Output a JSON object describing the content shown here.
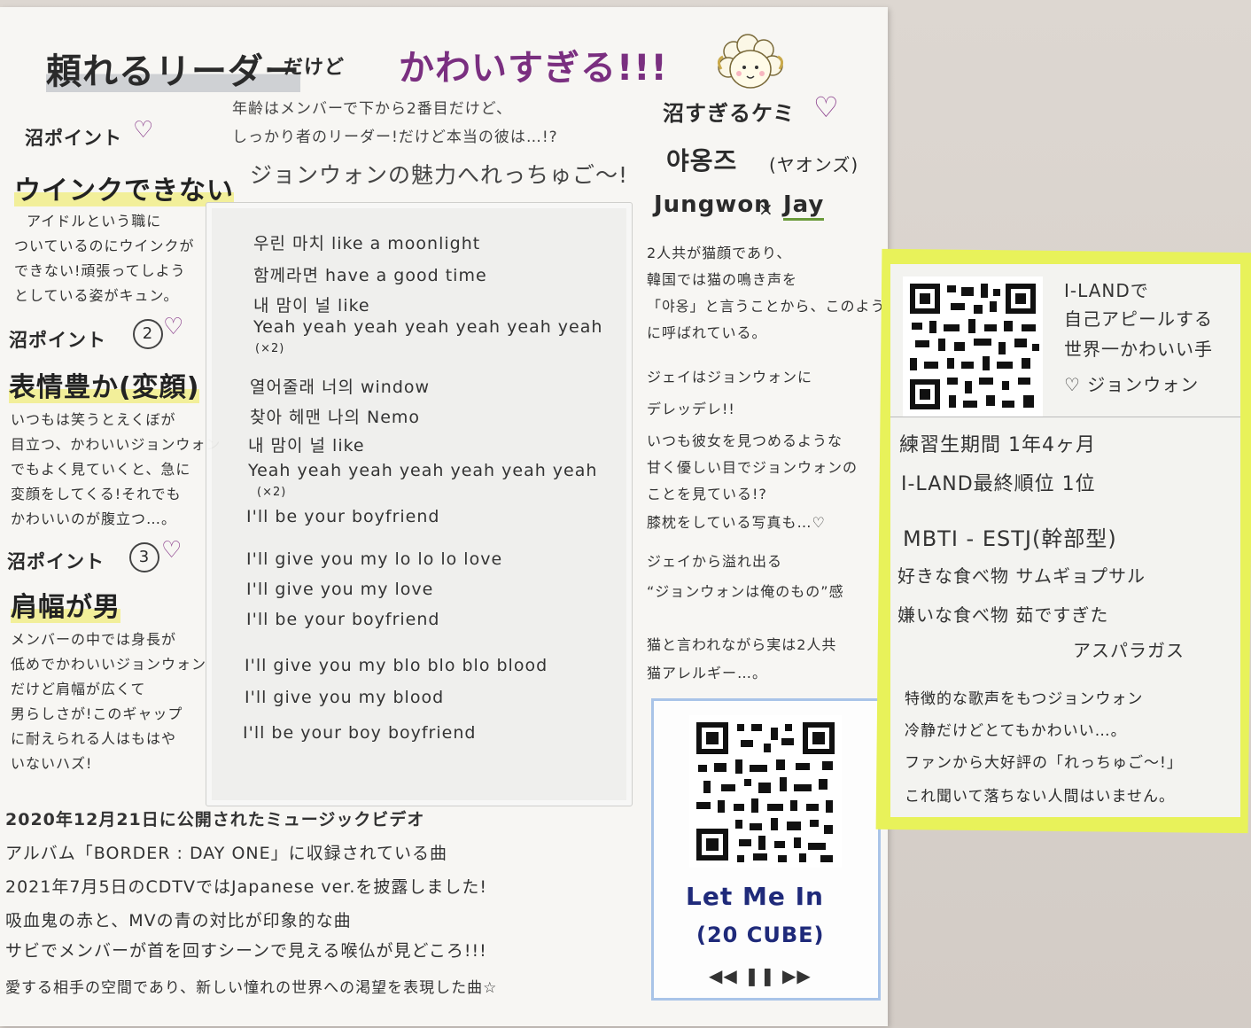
{
  "title": {
    "left": "頼れるリーダー",
    "mid": "だけど",
    "right": "かわいすぎる!!!"
  },
  "subtitle": {
    "line1": "年齢はメンバーで下から2番目だけど、",
    "line2": "しっかり者のリーダー!だけど本当の彼は…!?",
    "line3": "ジョンウォンの魅力へれっちゅご〜!"
  },
  "points": [
    {
      "label": "沼ポイント",
      "num": "",
      "heading": "ウインクできない",
      "body": [
        "アイドルという職に",
        "ついているのにウインクが",
        "できない!頑張ってしよう",
        "としている姿がキュン。"
      ]
    },
    {
      "label": "沼ポイント",
      "num": "2",
      "heading": "表情豊か(変顔)",
      "body": [
        "いつもは笑うとえくぼが",
        "目立つ、かわいいジョンウォン",
        "でもよく見ていくと、急に",
        "変顔をしてくる!それでも",
        "かわいいのが腹立つ…。"
      ]
    },
    {
      "label": "沼ポイント",
      "num": "3",
      "heading": "肩幅が男",
      "body": [
        "メンバーの中では身長が",
        "低めでかわいいジョンウォン",
        "だけど肩幅が広くて",
        "男らしさが!このギャップ",
        "に耐えられる人はもはや",
        "いないハズ!"
      ]
    }
  ],
  "lyrics": [
    "우린 마치 like a moonlight",
    "함께라면 have a good time",
    "내 맘이 널 like",
    "Yeah yeah yeah yeah yeah yeah yeah",
    "(×2)",
    "열어줄래 너의 window",
    "찾아 헤맨 나의 Nemo",
    "내 맘이 널 like",
    "Yeah yeah yeah yeah yeah yeah yeah",
    "(×2)",
    "I'll be your boyfriend",
    "I'll give you my lo lo lo love",
    "I'll give you my love",
    "I'll be your boyfriend",
    "I'll give you my blo blo blo blood",
    "I'll give you my blood",
    "I'll be your boy boyfriend"
  ],
  "chemistry": {
    "heading": "沼すぎるケミ",
    "korean": "야옹즈",
    "korean_reading": "(ヤオンズ)",
    "pair_left": "Jungwon",
    "pair_x": "×",
    "pair_right": "Jay",
    "body": [
      "2人共が猫顔であり、",
      "韓国では猫の鳴き声を",
      "「야옹」と言うことから、このよう",
      "に呼ばれている。",
      "ジェイはジョンウォンに",
      "デレッデレ!!",
      "いつも彼女を見つめるような",
      "甘く優しい目でジョンウォンの",
      "ことを見ている!?",
      "膝枕をしている写真も…♡",
      "ジェイから溢れ出る",
      "“ジョンウォンは俺のもの”感",
      "猫と言われながら実は2人共",
      "猫アレルギー…。"
    ]
  },
  "song": {
    "title": "Let Me In",
    "subtitle": "(20 CUBE)",
    "controls": "◀◀ ❚❚ ▶▶"
  },
  "bottom": [
    "2020年12月21日に公開されたミュージックビデオ",
    "アルバム「BORDER : DAY ONE」に収録されている曲",
    "2021年7月5日のCDTVではJapanese ver.を披露しました!",
    "吸血鬼の赤と、MVの青の対比が印象的な曲",
    "サビでメンバーが首を回すシーンで見える喉仏が見どころ!!!",
    "愛する相手の空間であり、新しい憧れの世界への渇望を表現した曲☆"
  ],
  "profile": {
    "iland_text": [
      "I-LANDで",
      "自己アピールする",
      "世界一かわいい手",
      "♡ ジョンウォン"
    ],
    "rows": [
      "練習生期間 1年4ヶ月",
      "I-LAND最終順位 1位",
      "MBTI - ESTJ(幹部型)",
      "好きな食べ物 サムギョプサル",
      "嫌いな食べ物 茹ですぎた",
      "アスパラガス"
    ],
    "closing": [
      "特徴的な歌声をもつジョンウォン",
      "冷静だけどとてもかわいい…。",
      "ファンから大好評の「れっちゅご〜!」",
      "これ聞いて落ちない人間はいません。"
    ]
  },
  "colors": {
    "kawaii_purple": "#7a2f80",
    "highlight_yellow": "#f2ef9a",
    "card_lime": "#e8f25a",
    "qr_border_blue": "#a9c4e8",
    "song_title_navy": "#1f2a7a"
  }
}
